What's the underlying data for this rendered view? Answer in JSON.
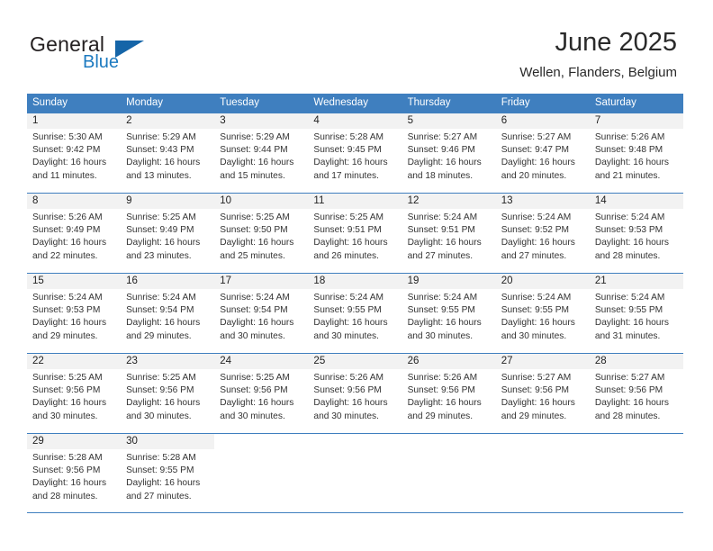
{
  "brand": {
    "name_top": "General",
    "name_bottom": "Blue",
    "flag_icon": "triangle-flag-icon",
    "color_dark": "#231f20",
    "color_blue": "#1c7ac0"
  },
  "header": {
    "month_title": "June 2025",
    "location": "Wellen, Flanders, Belgium"
  },
  "theme": {
    "header_blue": "#3f7fbf",
    "daynum_band": "#f2f2f2",
    "text": "#333333"
  },
  "weekdays": [
    "Sunday",
    "Monday",
    "Tuesday",
    "Wednesday",
    "Thursday",
    "Friday",
    "Saturday"
  ],
  "weeks": [
    [
      {
        "day": "1",
        "sunrise": "Sunrise: 5:30 AM",
        "sunset": "Sunset: 9:42 PM",
        "daylight_1": "Daylight: 16 hours",
        "daylight_2": "and 11 minutes."
      },
      {
        "day": "2",
        "sunrise": "Sunrise: 5:29 AM",
        "sunset": "Sunset: 9:43 PM",
        "daylight_1": "Daylight: 16 hours",
        "daylight_2": "and 13 minutes."
      },
      {
        "day": "3",
        "sunrise": "Sunrise: 5:29 AM",
        "sunset": "Sunset: 9:44 PM",
        "daylight_1": "Daylight: 16 hours",
        "daylight_2": "and 15 minutes."
      },
      {
        "day": "4",
        "sunrise": "Sunrise: 5:28 AM",
        "sunset": "Sunset: 9:45 PM",
        "daylight_1": "Daylight: 16 hours",
        "daylight_2": "and 17 minutes."
      },
      {
        "day": "5",
        "sunrise": "Sunrise: 5:27 AM",
        "sunset": "Sunset: 9:46 PM",
        "daylight_1": "Daylight: 16 hours",
        "daylight_2": "and 18 minutes."
      },
      {
        "day": "6",
        "sunrise": "Sunrise: 5:27 AM",
        "sunset": "Sunset: 9:47 PM",
        "daylight_1": "Daylight: 16 hours",
        "daylight_2": "and 20 minutes."
      },
      {
        "day": "7",
        "sunrise": "Sunrise: 5:26 AM",
        "sunset": "Sunset: 9:48 PM",
        "daylight_1": "Daylight: 16 hours",
        "daylight_2": "and 21 minutes."
      }
    ],
    [
      {
        "day": "8",
        "sunrise": "Sunrise: 5:26 AM",
        "sunset": "Sunset: 9:49 PM",
        "daylight_1": "Daylight: 16 hours",
        "daylight_2": "and 22 minutes."
      },
      {
        "day": "9",
        "sunrise": "Sunrise: 5:25 AM",
        "sunset": "Sunset: 9:49 PM",
        "daylight_1": "Daylight: 16 hours",
        "daylight_2": "and 23 minutes."
      },
      {
        "day": "10",
        "sunrise": "Sunrise: 5:25 AM",
        "sunset": "Sunset: 9:50 PM",
        "daylight_1": "Daylight: 16 hours",
        "daylight_2": "and 25 minutes."
      },
      {
        "day": "11",
        "sunrise": "Sunrise: 5:25 AM",
        "sunset": "Sunset: 9:51 PM",
        "daylight_1": "Daylight: 16 hours",
        "daylight_2": "and 26 minutes."
      },
      {
        "day": "12",
        "sunrise": "Sunrise: 5:24 AM",
        "sunset": "Sunset: 9:51 PM",
        "daylight_1": "Daylight: 16 hours",
        "daylight_2": "and 27 minutes."
      },
      {
        "day": "13",
        "sunrise": "Sunrise: 5:24 AM",
        "sunset": "Sunset: 9:52 PM",
        "daylight_1": "Daylight: 16 hours",
        "daylight_2": "and 27 minutes."
      },
      {
        "day": "14",
        "sunrise": "Sunrise: 5:24 AM",
        "sunset": "Sunset: 9:53 PM",
        "daylight_1": "Daylight: 16 hours",
        "daylight_2": "and 28 minutes."
      }
    ],
    [
      {
        "day": "15",
        "sunrise": "Sunrise: 5:24 AM",
        "sunset": "Sunset: 9:53 PM",
        "daylight_1": "Daylight: 16 hours",
        "daylight_2": "and 29 minutes."
      },
      {
        "day": "16",
        "sunrise": "Sunrise: 5:24 AM",
        "sunset": "Sunset: 9:54 PM",
        "daylight_1": "Daylight: 16 hours",
        "daylight_2": "and 29 minutes."
      },
      {
        "day": "17",
        "sunrise": "Sunrise: 5:24 AM",
        "sunset": "Sunset: 9:54 PM",
        "daylight_1": "Daylight: 16 hours",
        "daylight_2": "and 30 minutes."
      },
      {
        "day": "18",
        "sunrise": "Sunrise: 5:24 AM",
        "sunset": "Sunset: 9:55 PM",
        "daylight_1": "Daylight: 16 hours",
        "daylight_2": "and 30 minutes."
      },
      {
        "day": "19",
        "sunrise": "Sunrise: 5:24 AM",
        "sunset": "Sunset: 9:55 PM",
        "daylight_1": "Daylight: 16 hours",
        "daylight_2": "and 30 minutes."
      },
      {
        "day": "20",
        "sunrise": "Sunrise: 5:24 AM",
        "sunset": "Sunset: 9:55 PM",
        "daylight_1": "Daylight: 16 hours",
        "daylight_2": "and 30 minutes."
      },
      {
        "day": "21",
        "sunrise": "Sunrise: 5:24 AM",
        "sunset": "Sunset: 9:55 PM",
        "daylight_1": "Daylight: 16 hours",
        "daylight_2": "and 31 minutes."
      }
    ],
    [
      {
        "day": "22",
        "sunrise": "Sunrise: 5:25 AM",
        "sunset": "Sunset: 9:56 PM",
        "daylight_1": "Daylight: 16 hours",
        "daylight_2": "and 30 minutes."
      },
      {
        "day": "23",
        "sunrise": "Sunrise: 5:25 AM",
        "sunset": "Sunset: 9:56 PM",
        "daylight_1": "Daylight: 16 hours",
        "daylight_2": "and 30 minutes."
      },
      {
        "day": "24",
        "sunrise": "Sunrise: 5:25 AM",
        "sunset": "Sunset: 9:56 PM",
        "daylight_1": "Daylight: 16 hours",
        "daylight_2": "and 30 minutes."
      },
      {
        "day": "25",
        "sunrise": "Sunrise: 5:26 AM",
        "sunset": "Sunset: 9:56 PM",
        "daylight_1": "Daylight: 16 hours",
        "daylight_2": "and 30 minutes."
      },
      {
        "day": "26",
        "sunrise": "Sunrise: 5:26 AM",
        "sunset": "Sunset: 9:56 PM",
        "daylight_1": "Daylight: 16 hours",
        "daylight_2": "and 29 minutes."
      },
      {
        "day": "27",
        "sunrise": "Sunrise: 5:27 AM",
        "sunset": "Sunset: 9:56 PM",
        "daylight_1": "Daylight: 16 hours",
        "daylight_2": "and 29 minutes."
      },
      {
        "day": "28",
        "sunrise": "Sunrise: 5:27 AM",
        "sunset": "Sunset: 9:56 PM",
        "daylight_1": "Daylight: 16 hours",
        "daylight_2": "and 28 minutes."
      }
    ],
    [
      {
        "day": "29",
        "sunrise": "Sunrise: 5:28 AM",
        "sunset": "Sunset: 9:56 PM",
        "daylight_1": "Daylight: 16 hours",
        "daylight_2": "and 28 minutes."
      },
      {
        "day": "30",
        "sunrise": "Sunrise: 5:28 AM",
        "sunset": "Sunset: 9:55 PM",
        "daylight_1": "Daylight: 16 hours",
        "daylight_2": "and 27 minutes."
      },
      {
        "day": "",
        "sunrise": "",
        "sunset": "",
        "daylight_1": "",
        "daylight_2": ""
      },
      {
        "day": "",
        "sunrise": "",
        "sunset": "",
        "daylight_1": "",
        "daylight_2": ""
      },
      {
        "day": "",
        "sunrise": "",
        "sunset": "",
        "daylight_1": "",
        "daylight_2": ""
      },
      {
        "day": "",
        "sunrise": "",
        "sunset": "",
        "daylight_1": "",
        "daylight_2": ""
      },
      {
        "day": "",
        "sunrise": "",
        "sunset": "",
        "daylight_1": "",
        "daylight_2": ""
      }
    ]
  ]
}
